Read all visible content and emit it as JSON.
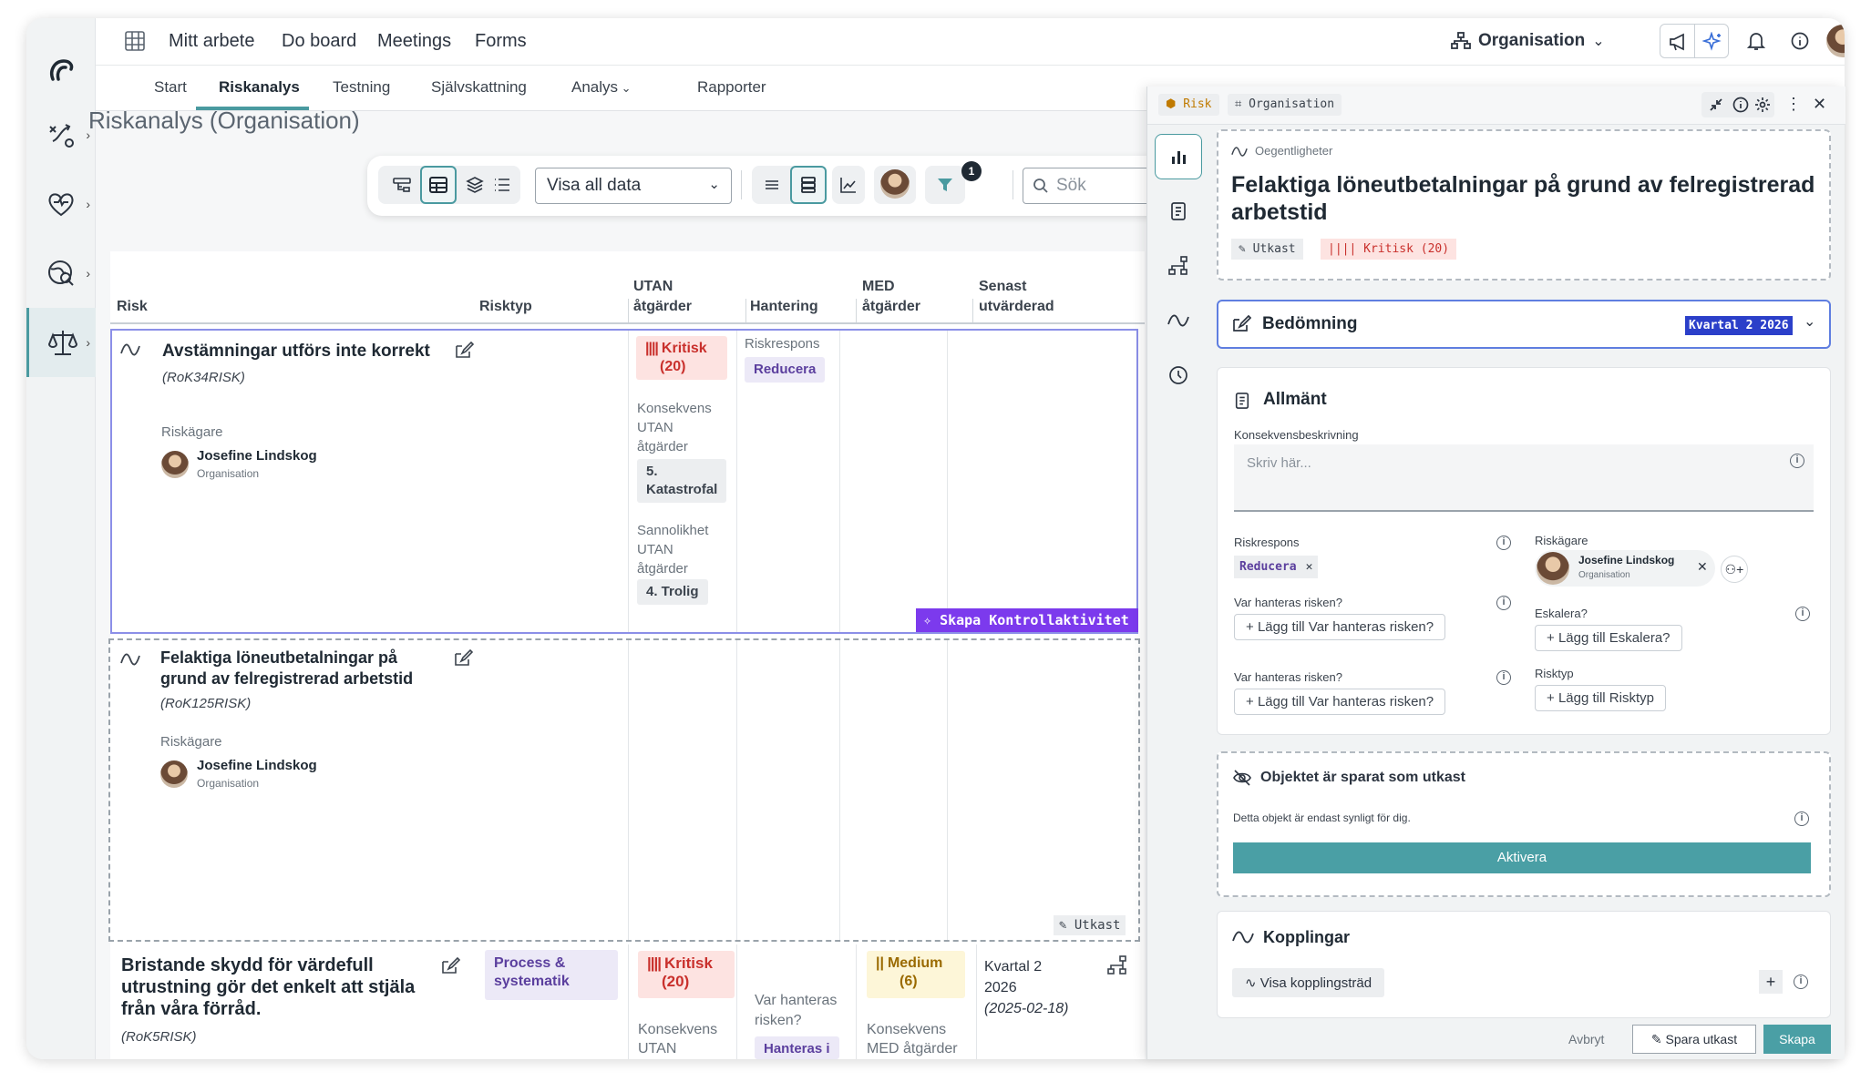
{
  "nav": {
    "items": [
      "Mitt arbete",
      "Do board",
      "Meetings",
      "Forms"
    ],
    "org_label": "Organisation"
  },
  "tabs": [
    "Start",
    "Riskanalys",
    "Testning",
    "Självskattning",
    "Analys",
    "Rapporter"
  ],
  "page_title": "Riskanalys (Organisation)",
  "toolbar": {
    "select_value": "Visa all data",
    "filter_count": "1",
    "search_placeholder": "Sök"
  },
  "table": {
    "headers": {
      "risk": "Risk",
      "risktyp": "Risktyp",
      "utan1": "UTAN",
      "utan2": "åtgärder",
      "hantering": "Hantering",
      "med1": "MED",
      "med2": "åtgärder",
      "senast1": "Senast",
      "senast2": "utvärderad"
    },
    "rows": [
      {
        "title": "Avstämningar utförs inte korrekt",
        "code": "(RoK34RISK)",
        "owner_label": "Riskägare",
        "owner": "Josefine Lindskog",
        "owner_org": "Organisation",
        "utan_level": "Kritisk",
        "utan_score": "(20)",
        "kons_label1": "Konsekvens",
        "kons_label2": "UTAN",
        "kons_label3": "åtgärder",
        "kons_value1": "5.",
        "kons_value2": "Katastrofal",
        "sann_label1": "Sannolikhet",
        "sann_label2": "UTAN",
        "sann_label3": "åtgärder",
        "sann_value": "4. Trolig",
        "resp_label": "Riskrespons",
        "resp_value": "Reducera",
        "action": "Skapa Kontrollaktivitet"
      },
      {
        "title1": "Felaktiga löneutbetalningar på",
        "title2": "grund av felregistrerad arbetstid",
        "code": "(RoK125RISK)",
        "owner_label": "Riskägare",
        "owner": "Josefine Lindskog",
        "owner_org": "Organisation",
        "status": "Utkast"
      },
      {
        "title1": "Bristande skydd för värdefull",
        "title2": "utrustning gör det enkelt att stjäla",
        "title3": "från våra förråd.",
        "code": "(RoK5RISK)",
        "risktyp1": "Process &",
        "risktyp2": "systematik",
        "utan_level": "Kritisk",
        "utan_score": "(20)",
        "kons_label1": "Konsekvens",
        "kons_label2": "UTAN",
        "q1": "Var hanteras",
        "q2": "risken?",
        "q_value": "Hanteras i",
        "med_level": "Medium",
        "med_score": "(6)",
        "med_kons1": "Konsekvens",
        "med_kons2": "MED åtgärder",
        "senast1": "Kvartal 2",
        "senast2": "2026",
        "senast3": "(2025-02-18)"
      }
    ]
  },
  "panel": {
    "chip_risk": "Risk",
    "chip_org": "Organisation",
    "category": "Oegentligheter",
    "title1": "Felaktiga löneutbetalningar på grund av felregistrerad",
    "title2": "arbetstid",
    "status_chip": "Utkast",
    "level_chip": "Kritisk (20)",
    "bedomning": "Bedömning",
    "period": "Kvartal 2 2026",
    "allmant": "Allmänt",
    "kons_label": "Konsekvensbeskrivning",
    "kons_placeholder": "Skriv här...",
    "riskrespons_label": "Riskrespons",
    "riskrespons_value": "Reducera",
    "riskagare_label": "Riskägare",
    "owner": "Josefine Lindskog",
    "owner_org": "Organisation",
    "var_label": "Var hanteras risken?",
    "var_add": "Lägg till Var hanteras risken?",
    "var2_label": "Var hanteras risken?",
    "var2_add": "Lägg till Var hanteras risken?",
    "esk_label": "Eskalera?",
    "esk_add": "Lägg till Eskalera?",
    "risktyp_label": "Risktyp",
    "risktyp_add": "Lägg till Risktyp",
    "draft_title": "Objektet är sparat som utkast",
    "draft_text": "Detta objekt är endast synligt för dig.",
    "activate": "Aktivera",
    "kopplingar": "Kopplingar",
    "visa": "Visa kopplingsträd",
    "cancel": "Avbryt",
    "save_draft": "Spara utkast",
    "create": "Skapa"
  },
  "colors": {
    "accent": "#4a9aa0",
    "critical": "#c9302c",
    "medium": "#9a6a00",
    "purple": "#7c3aed",
    "period_bg": "#2b3fc9"
  }
}
